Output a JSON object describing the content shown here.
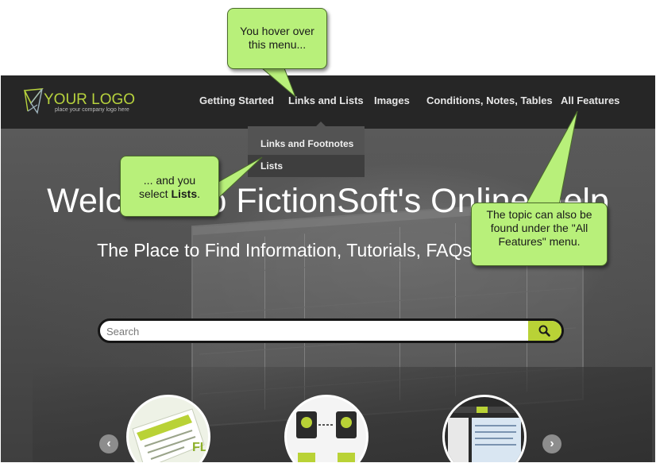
{
  "logo": {
    "text": "YOUR LOGO",
    "tagline": "place your company logo here"
  },
  "nav": {
    "items": [
      {
        "label": "Getting Started"
      },
      {
        "label": "Links and Lists"
      },
      {
        "label": "Images"
      },
      {
        "label": "Conditions, Notes, Tables"
      },
      {
        "label": "All Features"
      }
    ]
  },
  "dropdown": {
    "items": [
      {
        "label": "Links and Footnotes"
      },
      {
        "label": "Lists"
      }
    ]
  },
  "hero": {
    "title": "Welcome to FictionSoft's Online Help",
    "subtitle": "The Place to Find Information, Tutorials, FAQs, and More"
  },
  "search": {
    "placeholder": "Search",
    "button_icon": "search-icon"
  },
  "carousel": {
    "prev_icon": "chevron-left-icon",
    "next_icon": "chevron-right-icon",
    "partial_text": "FL"
  },
  "callouts": {
    "hover": {
      "line1": "You hover over",
      "line2": "this menu..."
    },
    "select": {
      "line1": "... and you",
      "line2_prefix": "select ",
      "line2_bold": "Lists",
      "line2_suffix": "."
    },
    "features": {
      "line1": "The topic can also be",
      "line2": "found under the \"All",
      "line3": "Features\" menu."
    }
  },
  "colors": {
    "accent": "#b9d236",
    "callout": "#b8f07a",
    "navbar": "#262626"
  }
}
